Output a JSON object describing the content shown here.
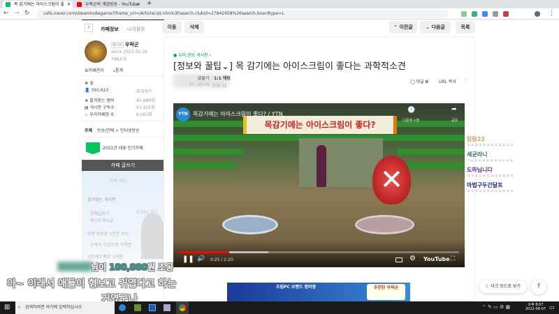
{
  "browser": {
    "tabs": [
      {
        "title": "목 감기에는 아이스크림이 좋",
        "active": true
      },
      {
        "title": "우락군의 게임방송 - YouTube",
        "active": false
      }
    ],
    "url": "cafe.naver.com/steamindiegame?iframe_url=/ArticleList.nhn%3Fsearch.clubid=27842958%26search.boardtype=L"
  },
  "cafe": {
    "tab_info": "카페정보",
    "tab_activity": "나의활동",
    "manager_badge": "매니저",
    "manager_name": "우락군",
    "since": "since 2015.02.26.",
    "intro": "카페소개",
    "manage": "카페관리",
    "stats": "통계",
    "level": "숲",
    "members": "393,623",
    "invite": "초대하기",
    "rows": [
      {
        "label": "즐겨찾는 멤버",
        "value": "40,689명"
      },
      {
        "label": "게시판 구독수",
        "value": "61,425회"
      },
      {
        "label": "우리카페앱 수",
        "value": "6,083회"
      }
    ],
    "topic_label": "주제",
    "topic": "방송/연예 > 인터넷방송",
    "badge_logo": "NAVER 대표카페",
    "badge_text": "2021년 대표 인기카페",
    "write_button": "카페 글쓰기",
    "chat": "카페 채팅",
    "fav_boards": "즐겨찾는 게시판",
    "board_items": [
      "전체글보기",
      "베스트게시글",
      "한번 방송한 1년은 쓰는",
      "우락이 이것으로 구역전",
      "이르래3 팬덤 고지전"
    ],
    "board_count": "9,541,707"
  },
  "toolbar": {
    "move": "이동",
    "delete": "삭제",
    "prev": "이전글",
    "next": "다음글",
    "list": "목록"
  },
  "post": {
    "board": "유머,정보 게시판",
    "title": "[정보와 꿀팁⌄] 목 감기에는 아이스크림이 좋다는 과학적소견",
    "author_suffix": "닭둘기",
    "chat_label": "1:1 채팅",
    "date": "07. 20:05",
    "views": "조회 11",
    "comments_label": "댓글",
    "comments": "0",
    "url_copy": "URL 복사"
  },
  "video": {
    "channel": "YTN",
    "title": "목감기에는 아이스크림이 좋다? / YTN",
    "banner": "목감기에는 아이스크림이 좋다?",
    "watch_later": "나중에 시청",
    "share": "공유",
    "time": "0:25 / 2:20",
    "progress": 0.18,
    "buffered": 0.32,
    "brand": "YouTube"
  },
  "stream_chat": [
    {
      "name": "탐탐22",
      "msg": "ㅋㅋㅋㅋㅋㅋㅋㅋㅋㅋㅋㅋ",
      "color": "#c8a860"
    },
    {
      "name": "세균라니",
      "msg": "ㄱㅇㅇㅇㅇㅇㅇㅇㅇㅇㅇㅇ",
      "color": "#3d6a6a"
    },
    {
      "name": "도하닙니다",
      "msg": "ㅋㅋㅋㅋㅋㅋㅋㅋㅋㅋㅋㅋ",
      "color": "#6a2a9a"
    },
    {
      "name": "마법구두간달프",
      "msg": "ㅋㅋㅋㅋㅋㅋㅋㅋㅋㅋㅋㅋ",
      "color": "#1a2a8a"
    }
  ],
  "overlay": {
    "donation_suffix": "님이",
    "donation_amount": "100,000",
    "donation_unit": "원 조공",
    "subtitle1": "아~ 이래서 애들이 형보고 귀엽다고 하는",
    "subtitle2": "거였구나"
  },
  "page_footer": {
    "dark_mode": "다크 모드로 보기",
    "ad_text": "조립PC 브랜드 컴마왕",
    "ad_badge": "추천인 우락군"
  },
  "taskbar": {
    "search_placeholder": "검색하려면 여기에 입력하십시오",
    "time": "오후 8:07",
    "date": "2022-08-07"
  }
}
